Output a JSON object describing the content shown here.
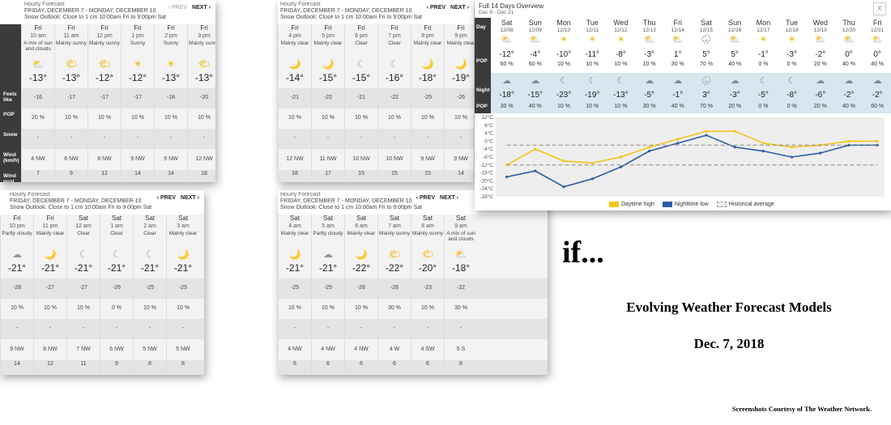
{
  "header": {
    "title": "Hourly Forecast",
    "dates": "FRIDAY, DECEMBER 7 - MONDAY, DECEMBER 10",
    "snow": "Snow Outlook: Close to 1 cm 10:00am Fri to 9:00pm Sat",
    "prev": "‹ PREV",
    "next": "NEXT ›"
  },
  "labels": {
    "feels": "Feels like",
    "pop": "POP",
    "snow": "Snow",
    "wind": "Wind (km/h)",
    "gust": "Wind gust (km/h)"
  },
  "panels": [
    {
      "cols": [
        {
          "day": "Fri",
          "time": "10 am",
          "cond": "A mix of sun and clouds",
          "icon": "⛅",
          "temp": "-13°",
          "feels": "-16",
          "pop": "20 %",
          "snow": "-",
          "wind": "4 NW",
          "gust": "7"
        },
        {
          "day": "Fri",
          "time": "11 am",
          "cond": "Mainly sunny",
          "icon": "🌤",
          "temp": "-13°",
          "feels": "-17",
          "pop": "10 %",
          "snow": "-",
          "wind": "6 NW",
          "gust": "9"
        },
        {
          "day": "Fri",
          "time": "12 pm",
          "cond": "Mainly sunny",
          "icon": "🌤",
          "temp": "-12°",
          "feels": "-17",
          "pop": "10 %",
          "snow": "-",
          "wind": "8 NW",
          "gust": "12"
        },
        {
          "day": "Fri",
          "time": "1 pm",
          "cond": "Sunny",
          "icon": "☀",
          "temp": "-12°",
          "feels": "-17",
          "pop": "10 %",
          "snow": "-",
          "wind": "9 NW",
          "gust": "14"
        },
        {
          "day": "Fri",
          "time": "2 pm",
          "cond": "Sunny",
          "icon": "☀",
          "temp": "-13°",
          "feels": "-18",
          "pop": "10 %",
          "snow": "-",
          "wind": "9 NW",
          "gust": "14"
        },
        {
          "day": "Fri",
          "time": "3 pm",
          "cond": "Mainly sunny",
          "icon": "🌤",
          "temp": "-13°",
          "feels": "-20",
          "pop": "10 %",
          "snow": "-",
          "wind": "12 NW",
          "gust": "18"
        }
      ]
    },
    {
      "cols": [
        {
          "day": "Fri",
          "time": "4 pm",
          "cond": "Mainly clear",
          "icon": "🌙",
          "temp": "-14°",
          "feels": "-21",
          "pop": "10 %",
          "snow": "-",
          "wind": "12 NW",
          "gust": "18"
        },
        {
          "day": "Fri",
          "time": "5 pm",
          "cond": "Mainly clear",
          "icon": "🌙",
          "temp": "-15°",
          "feels": "-22",
          "pop": "10 %",
          "snow": "-",
          "wind": "11 NW",
          "gust": "17"
        },
        {
          "day": "Fri",
          "time": "6 pm",
          "cond": "Clear",
          "icon": "☾",
          "temp": "-15°",
          "feels": "-21",
          "pop": "10 %",
          "snow": "-",
          "wind": "10 NW",
          "gust": "15"
        },
        {
          "day": "Fri",
          "time": "7 pm",
          "cond": "Clear",
          "icon": "☾",
          "temp": "-16°",
          "feels": "-22",
          "pop": "10 %",
          "snow": "-",
          "wind": "10 NW",
          "gust": "15"
        },
        {
          "day": "Fri",
          "time": "8 pm",
          "cond": "Mainly clear",
          "icon": "🌙",
          "temp": "-18°",
          "feels": "-25",
          "pop": "10 %",
          "snow": "-",
          "wind": "9 NW",
          "gust": "15"
        },
        {
          "day": "Fri",
          "time": "9 pm",
          "cond": "Mainly clear",
          "icon": "🌙",
          "temp": "-19°",
          "feels": "-26",
          "pop": "10 %",
          "snow": "-",
          "wind": "9 NW",
          "gust": "14"
        }
      ]
    },
    {
      "cols": [
        {
          "day": "Fri",
          "time": "10 pm",
          "cond": "Partly cloudy",
          "icon": "☁",
          "temp": "-21°",
          "feels": "-28",
          "pop": "10 %",
          "snow": "-",
          "wind": "9 NW",
          "gust": "14"
        },
        {
          "day": "Fri",
          "time": "11 pm",
          "cond": "Mainly clear",
          "icon": "🌙",
          "temp": "-21°",
          "feels": "-27",
          "pop": "10 %",
          "snow": "-",
          "wind": "8 NW",
          "gust": "12"
        },
        {
          "day": "Sat",
          "time": "12 am",
          "cond": "Clear",
          "icon": "☾",
          "temp": "-21°",
          "feels": "-27",
          "pop": "10 %",
          "snow": "-",
          "wind": "7 NW",
          "gust": "11"
        },
        {
          "day": "Sat",
          "time": "1 am",
          "cond": "Clear",
          "icon": "☾",
          "temp": "-21°",
          "feels": "-26",
          "pop": "0 %",
          "snow": "-",
          "wind": "6 NW",
          "gust": "9"
        },
        {
          "day": "Sat",
          "time": "2 am",
          "cond": "Clear",
          "icon": "☾",
          "temp": "-21°",
          "feels": "-25",
          "pop": "10 %",
          "snow": "-",
          "wind": "5 NW",
          "gust": "8"
        },
        {
          "day": "Sat",
          "time": "3 am",
          "cond": "Mainly clear",
          "icon": "🌙",
          "temp": "-21°",
          "feels": "-25",
          "pop": "10 %",
          "snow": "-",
          "wind": "5 NW",
          "gust": "8"
        }
      ]
    },
    {
      "cols": [
        {
          "day": "Sat",
          "time": "4 am",
          "cond": "Mainly clear",
          "icon": "🌙",
          "temp": "-21°",
          "feels": "-25",
          "pop": "10 %",
          "snow": "-",
          "wind": "4 NW",
          "gust": "6"
        },
        {
          "day": "Sat",
          "time": "5 am",
          "cond": "Partly cloudy",
          "icon": "☁",
          "temp": "-21°",
          "feels": "-25",
          "pop": "10 %",
          "snow": "-",
          "wind": "4 NW",
          "gust": "6"
        },
        {
          "day": "Sat",
          "time": "6 am",
          "cond": "Mainly clear",
          "icon": "🌙",
          "temp": "-22°",
          "feels": "-26",
          "pop": "10 %",
          "snow": "-",
          "wind": "4 NW",
          "gust": "6"
        },
        {
          "day": "Sat",
          "time": "7 am",
          "cond": "Mainly sunny",
          "icon": "🌤",
          "temp": "-22°",
          "feels": "-26",
          "pop": "30 %",
          "snow": "-",
          "wind": "4 W",
          "gust": "6"
        },
        {
          "day": "Sat",
          "time": "8 am",
          "cond": "Mainly sunny",
          "icon": "🌤",
          "temp": "-20°",
          "feels": "-23",
          "pop": "10 %",
          "snow": "-",
          "wind": "4 SW",
          "gust": "6"
        },
        {
          "day": "Sat",
          "time": "9 am",
          "cond": "A mix of sun and clouds",
          "icon": "⛅",
          "temp": "-18°",
          "feels": "-22",
          "pop": "30 %",
          "snow": "-",
          "wind": "5 S",
          "gust": "8"
        }
      ]
    }
  ],
  "overview": {
    "title": "Full 14 Days Overview",
    "range": "Dec 8 - Dec 21",
    "close": "X",
    "day_label": "Day",
    "night_label": "Night",
    "pop_label": "POP",
    "days": [
      {
        "dow": "Sat",
        "date": "12/08",
        "dicon": "⛅",
        "dtemp": "-12°",
        "dpop": "60 %",
        "nicon": "☁",
        "ntemp": "-18°",
        "npop": "30 %"
      },
      {
        "dow": "Sun",
        "date": "12/09",
        "dicon": "⛅",
        "dtemp": "-4°",
        "dpop": "60 %",
        "nicon": "☁",
        "ntemp": "-15°",
        "npop": "40 %"
      },
      {
        "dow": "Mon",
        "date": "12/10",
        "dicon": "☀",
        "dtemp": "-10°",
        "dpop": "10 %",
        "nicon": "☾",
        "ntemp": "-23°",
        "npop": "10 %"
      },
      {
        "dow": "Tue",
        "date": "12/11",
        "dicon": "☀",
        "dtemp": "-11°",
        "dpop": "10 %",
        "nicon": "☾",
        "ntemp": "-19°",
        "npop": "10 %"
      },
      {
        "dow": "Wed",
        "date": "12/12",
        "dicon": "☀",
        "dtemp": "-8°",
        "dpop": "10 %",
        "nicon": "☾",
        "ntemp": "-13°",
        "npop": "10 %"
      },
      {
        "dow": "Thu",
        "date": "12/13",
        "dicon": "⛅",
        "dtemp": "-3°",
        "dpop": "10 %",
        "nicon": "☁",
        "ntemp": "-5°",
        "npop": "30 %"
      },
      {
        "dow": "Fri",
        "date": "12/14",
        "dicon": "⛅",
        "dtemp": "1°",
        "dpop": "30 %",
        "nicon": "☁",
        "ntemp": "-1°",
        "npop": "40 %"
      },
      {
        "dow": "Sat",
        "date": "12/15",
        "dicon": "🌧",
        "dtemp": "5°",
        "dpop": "70 %",
        "nicon": "🌧",
        "ntemp": "3°",
        "npop": "70 %"
      },
      {
        "dow": "Sun",
        "date": "12/16",
        "dicon": "⛅",
        "dtemp": "5°",
        "dpop": "40 %",
        "nicon": "☁",
        "ntemp": "-3°",
        "npop": "20 %"
      },
      {
        "dow": "Mon",
        "date": "12/17",
        "dicon": "☀",
        "dtemp": "-1°",
        "dpop": "0 %",
        "nicon": "☾",
        "ntemp": "-5°",
        "npop": "0 %"
      },
      {
        "dow": "Tue",
        "date": "12/18",
        "dicon": "☀",
        "dtemp": "-3°",
        "dpop": "0 %",
        "nicon": "☾",
        "ntemp": "-8°",
        "npop": "0 %"
      },
      {
        "dow": "Wed",
        "date": "12/19",
        "dicon": "⛅",
        "dtemp": "-2°",
        "dpop": "20 %",
        "nicon": "☁",
        "ntemp": "-6°",
        "npop": "20 %"
      },
      {
        "dow": "Thu",
        "date": "12/20",
        "dicon": "⛅",
        "dtemp": "0°",
        "dpop": "40 %",
        "nicon": "☁",
        "ntemp": "-2°",
        "npop": "40 %"
      },
      {
        "dow": "Fri",
        "date": "12/21",
        "dicon": "⛅",
        "dtemp": "0°",
        "dpop": "40 %",
        "nicon": "☁",
        "ntemp": "-2°",
        "npop": "60 %"
      }
    ],
    "legend": {
      "high": "Daytime high",
      "low": "Nighttime low",
      "avg": "Historical average"
    }
  },
  "chart_data": {
    "type": "line",
    "x": [
      "12/08",
      "12/09",
      "12/10",
      "12/11",
      "12/12",
      "12/13",
      "12/14",
      "12/15",
      "12/16",
      "12/17",
      "12/18",
      "12/19",
      "12/20",
      "12/21"
    ],
    "series": [
      {
        "name": "Daytime high",
        "color": "#f5c518",
        "values": [
          -12,
          -4,
          -10,
          -11,
          -8,
          -3,
          1,
          5,
          5,
          -1,
          -3,
          -2,
          0,
          0
        ]
      },
      {
        "name": "Nighttime low",
        "color": "#2a5da8",
        "values": [
          -18,
          -15,
          -23,
          -19,
          -13,
          -5,
          -1,
          3,
          -3,
          -5,
          -8,
          -6,
          -2,
          -2
        ]
      },
      {
        "name": "Historical average",
        "color": "#888",
        "values": [
          -2,
          -2,
          -2,
          -2,
          -2,
          -2,
          -2,
          -2,
          -2,
          -2,
          -2,
          -2,
          -2,
          -2
        ]
      },
      {
        "name": "Historical average",
        "color": "#888",
        "values": [
          -12,
          -12,
          -12,
          -12,
          -12,
          -12,
          -12,
          -12,
          -12,
          -12,
          -12,
          -12,
          -12,
          -12
        ]
      }
    ],
    "yticks": [
      "12°C",
      "8°C",
      "4°C",
      "0°C",
      "-4°C",
      "-8°C",
      "-12°C",
      "-16°C",
      "-20°C",
      "-24°C",
      "-28°C"
    ],
    "ylim": [
      -28,
      12
    ]
  },
  "slide": {
    "if": "if...",
    "subtitle": "Evolving Weather Forecast Models",
    "date": "Dec. 7, 2018",
    "credit": "Screenshots Courtesy of The Weather Network."
  },
  "colors": {
    "label_bg": "#3b3b3b",
    "day_row": "#ffffff",
    "night_row": "#d8e6f0",
    "high": "#f5c518",
    "low": "#2a5da8"
  }
}
